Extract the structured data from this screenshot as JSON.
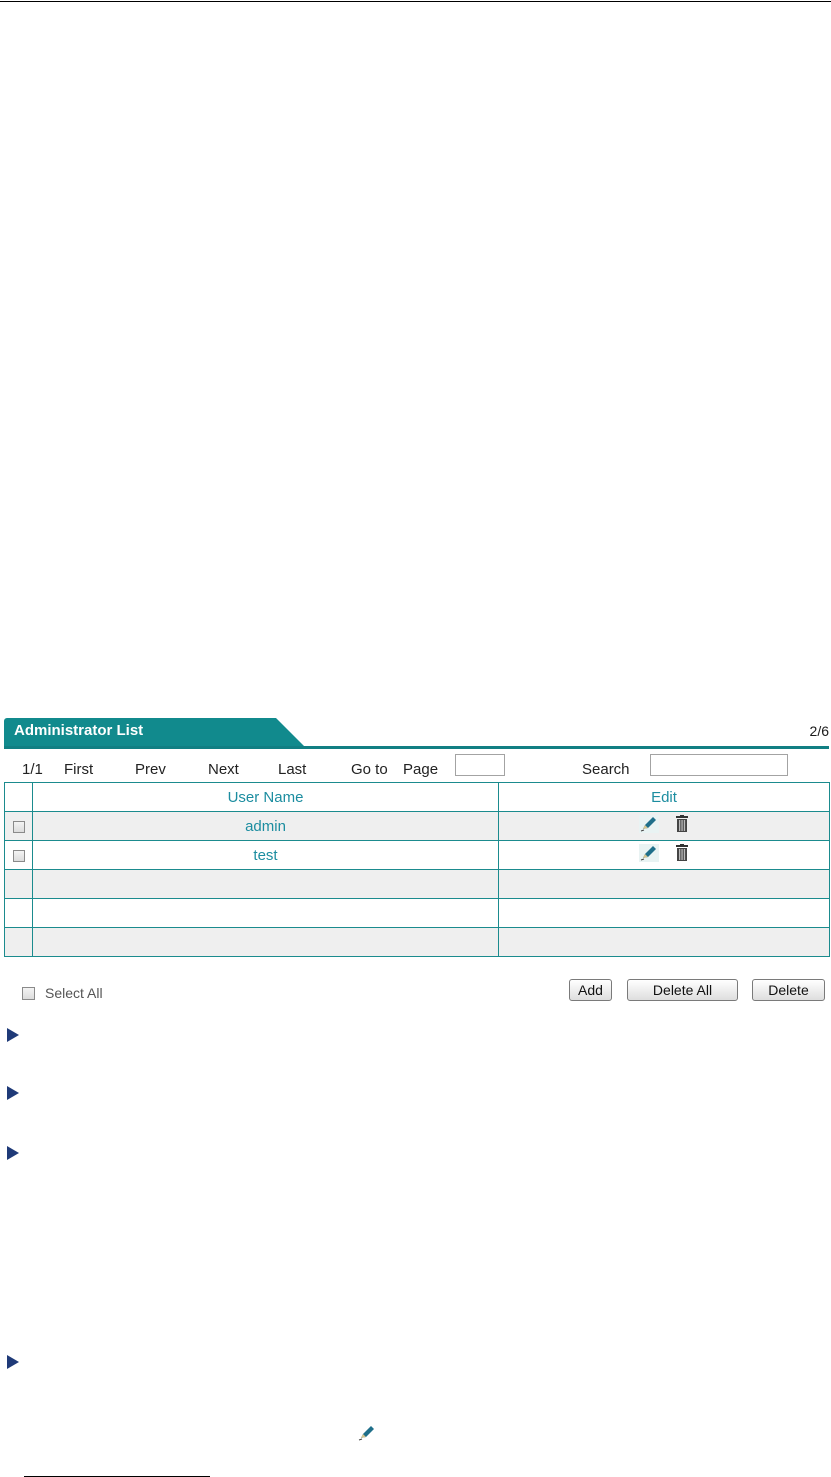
{
  "panel": {
    "title": "Administrator List",
    "page_count": "2/6"
  },
  "pager": {
    "position": "1/1",
    "first": "First",
    "prev": "Prev",
    "next": "Next",
    "last": "Last",
    "goto": "Go to",
    "page": "Page",
    "page_value": "",
    "search": "Search",
    "search_value": ""
  },
  "table": {
    "columns": [
      "User Name",
      "Edit"
    ],
    "rows": [
      {
        "name": "admin"
      },
      {
        "name": "test"
      },
      {
        "name": ""
      },
      {
        "name": ""
      },
      {
        "name": ""
      }
    ]
  },
  "footer": {
    "select_all": "Select All",
    "add": "Add",
    "delete_all": "Delete All",
    "delete": "Delete"
  },
  "icons": {
    "edit": "pencil-edit-icon",
    "delete": "trash-icon",
    "bullet": "arrow-bullet-icon",
    "accent": "#118a8d",
    "bullet_color": "#1f3a78"
  }
}
